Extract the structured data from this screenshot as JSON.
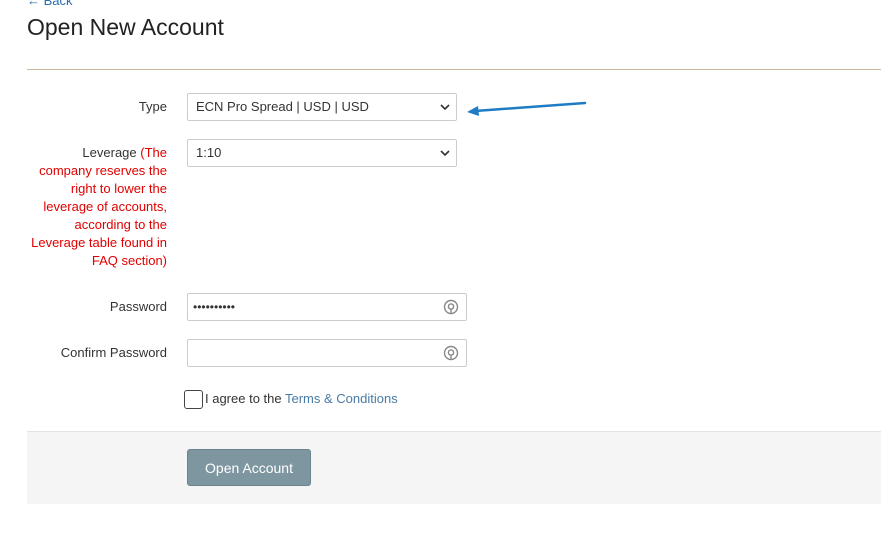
{
  "nav": {
    "back_label": "← Back"
  },
  "page": {
    "title": "Open New Account"
  },
  "form": {
    "type": {
      "label": "Type",
      "selected": "ECN Pro Spread | USD | USD"
    },
    "leverage": {
      "label": "Leverage",
      "note_lines": [
        "(The",
        "company reserves the",
        "right to lower the",
        "leverage of accounts,",
        "according to the",
        "Leverage table found in",
        "FAQ section)"
      ],
      "selected": "1:10"
    },
    "password": {
      "label": "Password",
      "value": "••••••••••"
    },
    "confirm_password": {
      "label": "Confirm Password",
      "value": ""
    },
    "agree": {
      "text": "I agree to the ",
      "link": "Terms & Conditions"
    },
    "submit_label": "Open Account"
  },
  "colors": {
    "arrow": "#1e7bc4",
    "note": "#e00000",
    "button": "#7e96a0",
    "link": "#4a7ba6"
  }
}
